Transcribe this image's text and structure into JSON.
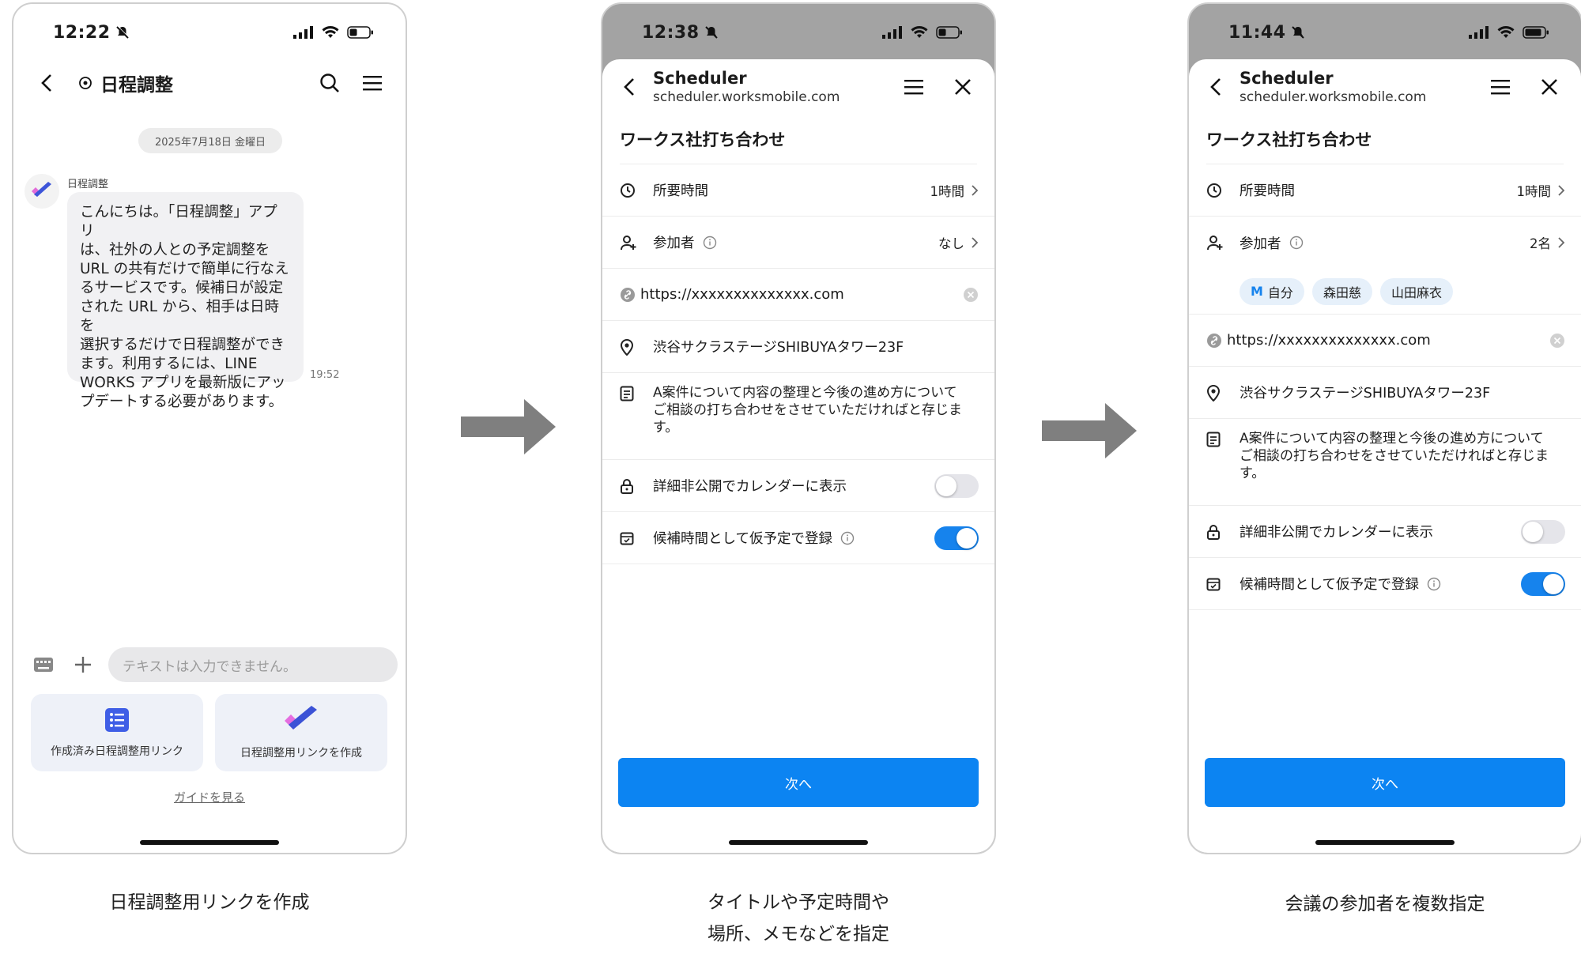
{
  "screen1": {
    "status_time": "12:22",
    "header_title": "日程調整",
    "date_label": "2025年7月18日 金曜日",
    "bot_name": "日程調整",
    "message_lines": [
      "こんにちは。「日程調整」アプリ",
      "は、社外の人との予定調整を",
      "URL の共有だけで簡単に行なえ",
      "るサービスです。候補日が設定",
      "された URL から、相手は日時を",
      "選択するだけで日程調整ができ",
      "ます。利用するには、LINE",
      "WORKS アプリを最新版にアッ",
      "プデートする必要があります。"
    ],
    "message_time": "19:52",
    "input_placeholder": "テキストは入力できません。",
    "quick_left_label": "作成済み日程調整用リンク",
    "quick_right_label": "日程調整用リンクを作成",
    "guide_link": "ガイドを見る"
  },
  "screen2": {
    "status_time": "12:38",
    "app_title": "Scheduler",
    "app_url": "scheduler.worksmobile.com",
    "event_title": "ワークス社打ち合わせ",
    "duration_label": "所要時間",
    "duration_value": "1時間",
    "attendees_label": "参加者",
    "attendees_value": "なし",
    "url_value": "https://xxxxxxxxxxxxxx.com",
    "location": "渋谷サクラステージSHIBUYAタワー23F",
    "memo_lines": [
      "A案件について内容の整理と今後の進め方について",
      "ご相談の打ち合わせをさせていただければと存じま",
      "す。"
    ],
    "private_label": "詳細非公開でカレンダーに表示",
    "private_on": false,
    "tentative_label": "候補時間として仮予定で登録",
    "tentative_on": true,
    "next_button": "次へ"
  },
  "screen3": {
    "status_time": "11:44",
    "app_title": "Scheduler",
    "app_url": "scheduler.worksmobile.com",
    "event_title": "ワークス社打ち合わせ",
    "duration_label": "所要時間",
    "duration_value": "1時間",
    "attendees_label": "参加者",
    "attendees_value": "2名",
    "chip_self_prefix": "M",
    "chip_self": "自分",
    "chip_2": "森田慈",
    "chip_3": "山田麻衣",
    "url_value": "https://xxxxxxxxxxxxxx.com",
    "location": "渋谷サクラステージSHIBUYAタワー23F",
    "memo_lines": [
      "A案件について内容の整理と今後の進め方について",
      "ご相談の打ち合わせをさせていただければと存じま",
      "す。"
    ],
    "private_label": "詳細非公開でカレンダーに表示",
    "private_on": false,
    "tentative_label": "候補時間として仮予定で登録",
    "tentative_on": true,
    "next_button": "次へ"
  },
  "captions": {
    "caption1": "日程調整用リンクを作成",
    "caption2_line1": "タイトルや予定時間や",
    "caption2_line2": "場所、メモなどを指定",
    "caption3": "会議の参加者を複数指定"
  },
  "colors": {
    "accent": "#0c84f2",
    "arrow": "#7f7f7f",
    "sheet_backdrop": "#a3a3a3"
  }
}
